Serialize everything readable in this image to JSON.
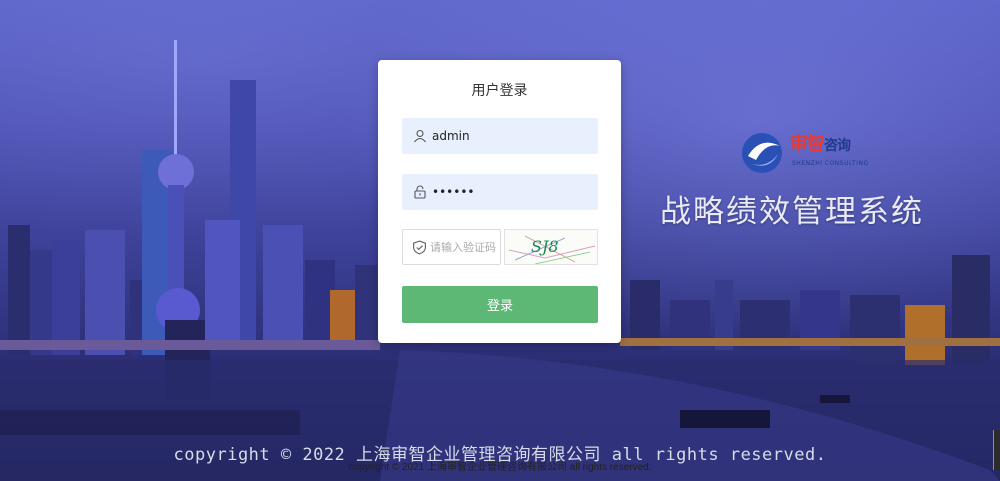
{
  "login": {
    "title": "用户登录",
    "username_value": "admin",
    "password_value": "••••••",
    "captcha_placeholder": "请输入验证码",
    "captcha_text": "SJ8",
    "submit_label": "登录"
  },
  "brand": {
    "logo_cn_1": "审智",
    "logo_cn_2": "咨询",
    "logo_en": "SHENZHI CONSULTING",
    "system_title": "战略绩效管理系统"
  },
  "footer": {
    "copyright_big": "copyright © 2022 上海审智企业管理咨询有限公司 all rights reserved.",
    "copyright_small": "copyright © 2021 上海审智企业管理咨询有限公司 all rights reserved."
  },
  "colors": {
    "button": "#5cb874",
    "field_bg": "#e8f0fe",
    "logo_red": "#e23b3b",
    "logo_blue": "#1e3a8a"
  },
  "icons": [
    "user-icon",
    "lock-icon",
    "shield-icon"
  ]
}
